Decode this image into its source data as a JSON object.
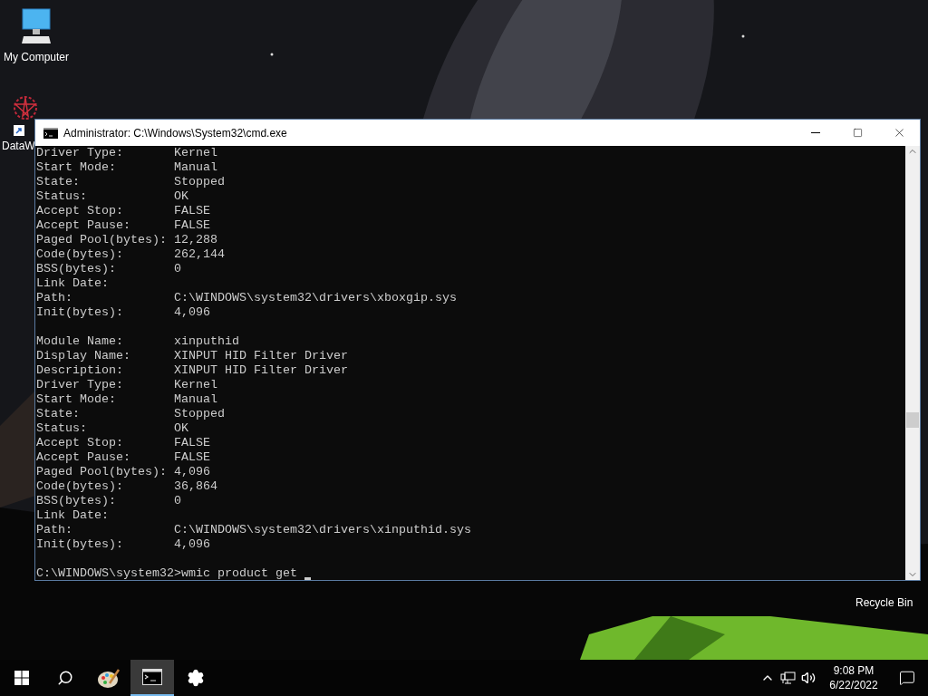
{
  "desktop_icons": [
    {
      "label": "My Computer",
      "kind": "computer"
    },
    {
      "label": "DataW",
      "kind": "app"
    },
    {
      "label": "Recycle Bin",
      "kind": "bin"
    }
  ],
  "window": {
    "title": "Administrator: C:\\Windows\\System32\\cmd.exe"
  },
  "console": {
    "records": [
      {
        "fields": [
          {
            "label": "Driver Type:",
            "value": "Kernel"
          },
          {
            "label": "Start Mode:",
            "value": "Manual"
          },
          {
            "label": "State:",
            "value": "Stopped"
          },
          {
            "label": "Status:",
            "value": "OK"
          },
          {
            "label": "Accept Stop:",
            "value": "FALSE"
          },
          {
            "label": "Accept Pause:",
            "value": "FALSE"
          },
          {
            "label": "Paged Pool(bytes):",
            "value": "12,288"
          },
          {
            "label": "Code(bytes):",
            "value": "262,144"
          },
          {
            "label": "BSS(bytes):",
            "value": "0"
          },
          {
            "label": "Link Date:"
          },
          {
            "label": "Path:",
            "value": "C:\\WINDOWS\\system32\\drivers\\xboxgip.sys"
          },
          {
            "label": "Init(bytes):",
            "value": "4,096"
          }
        ]
      },
      {
        "fields": [
          {
            "label": "Module Name:",
            "value": "xinputhid"
          },
          {
            "label": "Display Name:",
            "value": "XINPUT HID Filter Driver"
          },
          {
            "label": "Description:",
            "value": "XINPUT HID Filter Driver"
          },
          {
            "label": "Driver Type:",
            "value": "Kernel"
          },
          {
            "label": "Start Mode:",
            "value": "Manual"
          },
          {
            "label": "State:",
            "value": "Stopped"
          },
          {
            "label": "Status:",
            "value": "OK"
          },
          {
            "label": "Accept Stop:",
            "value": "FALSE"
          },
          {
            "label": "Accept Pause:",
            "value": "FALSE"
          },
          {
            "label": "Paged Pool(bytes):",
            "value": "4,096"
          },
          {
            "label": "Code(bytes):",
            "value": "36,864"
          },
          {
            "label": "BSS(bytes):",
            "value": "0"
          },
          {
            "label": "Link Date:"
          },
          {
            "label": "Path:",
            "value": "C:\\WINDOWS\\system32\\drivers\\xinputhid.sys"
          },
          {
            "label": "Init(bytes):",
            "value": "4,096"
          }
        ]
      }
    ],
    "prompt": "C:\\WINDOWS\\system32>wmic product get"
  },
  "taskbar": {
    "apps": [
      {
        "kind": "start",
        "selected": false
      },
      {
        "kind": "search",
        "selected": false
      },
      {
        "kind": "paint",
        "selected": false
      },
      {
        "kind": "console",
        "selected": true
      },
      {
        "kind": "settings",
        "selected": false
      }
    ],
    "time": "9:08 PM",
    "date": "6/22/2022"
  }
}
